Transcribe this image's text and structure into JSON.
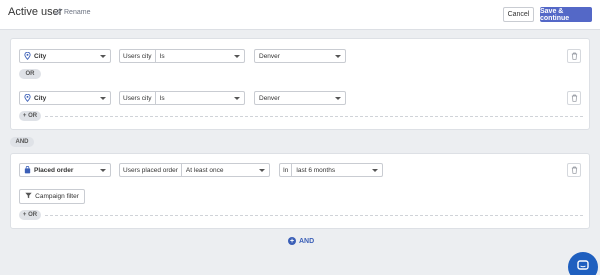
{
  "header": {
    "title": "Active user",
    "rename_label": "Rename",
    "cancel_label": "Cancel",
    "save_label": "Save & continue"
  },
  "group1": {
    "rules": [
      {
        "attribute": "City",
        "field_label": "Users city",
        "operator": "Is",
        "value": "Denver"
      },
      {
        "attribute": "City",
        "field_label": "Users city",
        "operator": "Is",
        "value": "Denver"
      }
    ],
    "or_label": "OR",
    "add_or_label": "+ OR"
  },
  "and_label": "AND",
  "group2": {
    "rule": {
      "attribute": "Placed order",
      "field_label": "Users placed order",
      "operator": "At least once",
      "in_label": "In",
      "period": "last 6 months"
    },
    "campaign_filter_label": "Campaign filter",
    "add_or_label": "+ OR"
  },
  "add_and_label": "AND",
  "colors": {
    "primary": "#5468c7",
    "link": "#3b5fb7",
    "chat": "#1f5fbf"
  }
}
